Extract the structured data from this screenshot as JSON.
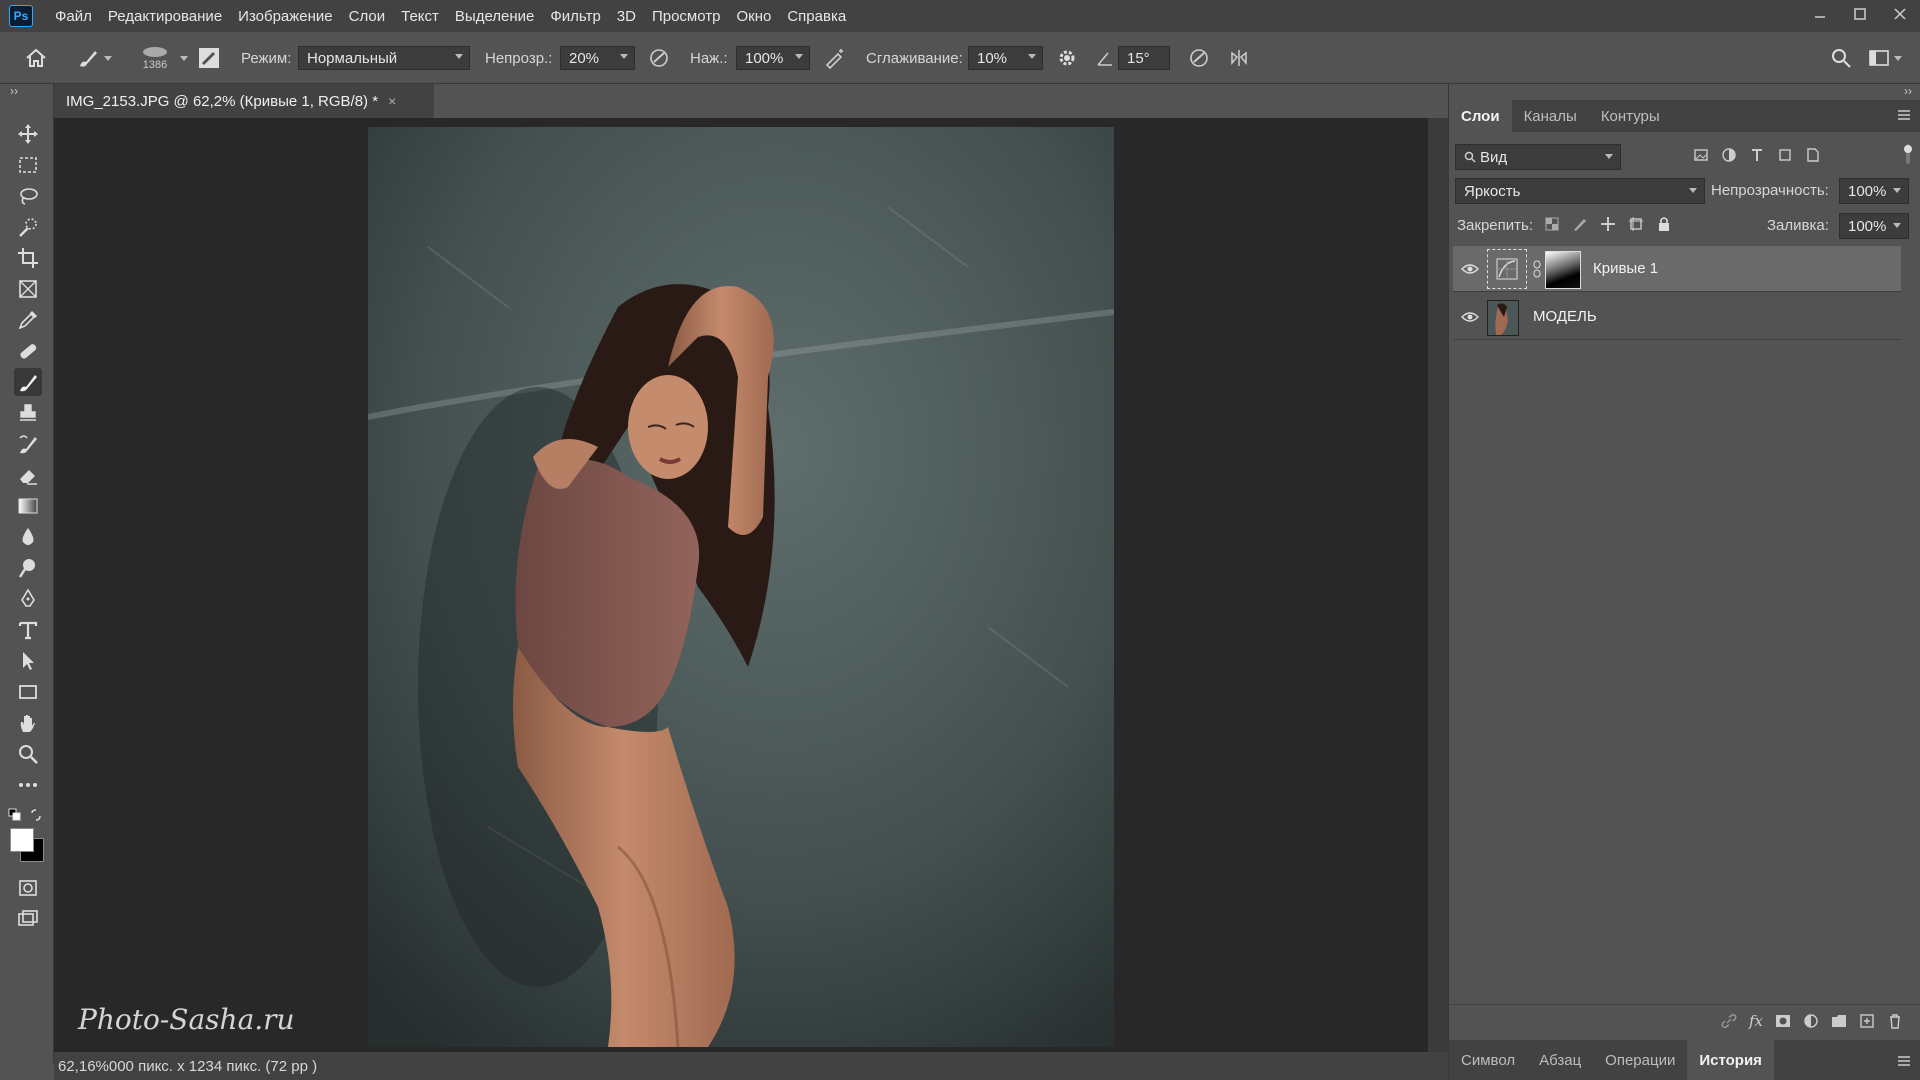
{
  "app": {
    "logo": "Ps"
  },
  "menu": [
    "Файл",
    "Редактирование",
    "Изображение",
    "Слои",
    "Текст",
    "Выделение",
    "Фильтр",
    "3D",
    "Просмотр",
    "Окно",
    "Справка"
  ],
  "options": {
    "brush_size": "1386",
    "mode_label": "Режим:",
    "mode_value": "Нормальный",
    "opacity_label": "Непрозр.:",
    "opacity_value": "20%",
    "flow_label": "Наж.:",
    "flow_value": "100%",
    "smoothing_label": "Сглаживание:",
    "smoothing_value": "10%",
    "angle_value": "15°"
  },
  "document": {
    "tab_title": "IMG_2153.JPG @ 62,2% (Кривые 1, RGB/8) *",
    "close": "×",
    "status": "62,16%000 пикс. x 1234 пикс. (72 pp )",
    "watermark": "Photo-Sasha.ru"
  },
  "panels": {
    "tabs": [
      "Слои",
      "Каналы",
      "Контуры"
    ],
    "filter_value": "Вид",
    "blend_mode": "Яркость",
    "opacity_label": "Непрозрачность:",
    "opacity_value": "100%",
    "lock_label": "Закрепить:",
    "fill_label": "Заливка:",
    "fill_value": "100%",
    "layers": [
      {
        "name": "Кривые 1",
        "selected": true
      },
      {
        "name": "МОДЕЛЬ",
        "selected": false
      }
    ],
    "bottom_tabs": [
      "Символ",
      "Абзац",
      "Операции",
      "История"
    ]
  },
  "colors": {
    "accent": "#31a8ff",
    "bg": "#535353",
    "canvas": "#282828"
  }
}
